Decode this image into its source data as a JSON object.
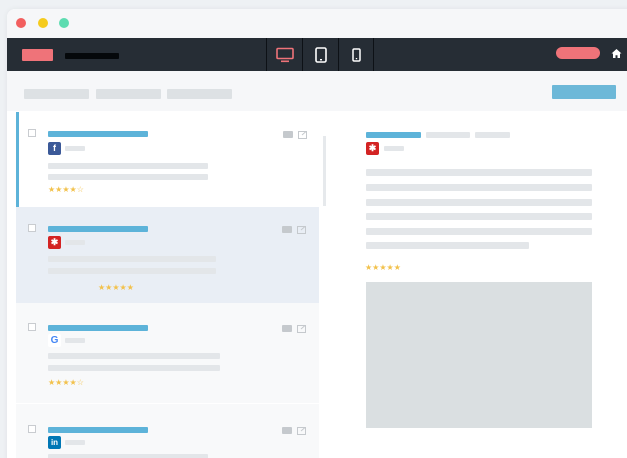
{
  "window": {
    "controls": [
      "close",
      "minimize",
      "maximize"
    ]
  },
  "appbar": {
    "device_icons": [
      "desktop-icon",
      "tablet-icon",
      "mobile-icon"
    ],
    "active_device": "desktop-icon",
    "home_icon": "home-icon"
  },
  "list": {
    "items": [
      {
        "source": "facebook",
        "source_glyph": "f",
        "stars": "★★★★☆",
        "state": "selected"
      },
      {
        "source": "yelp",
        "source_glyph": "✱",
        "stars": "★★★★★",
        "state": "hover"
      },
      {
        "source": "google",
        "source_glyph": "G",
        "stars": "★★★★☆",
        "state": "plain"
      },
      {
        "source": "linkedin",
        "source_glyph": "in",
        "stars": "",
        "state": "plain"
      }
    ]
  },
  "detail": {
    "source": "yelp",
    "source_glyph": "✱",
    "stars": "★★★★★"
  },
  "colors": {
    "accent": "#5db3d9",
    "appbar": "#262d35",
    "brand_pink": "#ef7379",
    "star": "#f2c14b",
    "facebook": "#3b5998",
    "yelp": "#d32323",
    "linkedin": "#0077b5",
    "google_blue": "#4285f4"
  }
}
